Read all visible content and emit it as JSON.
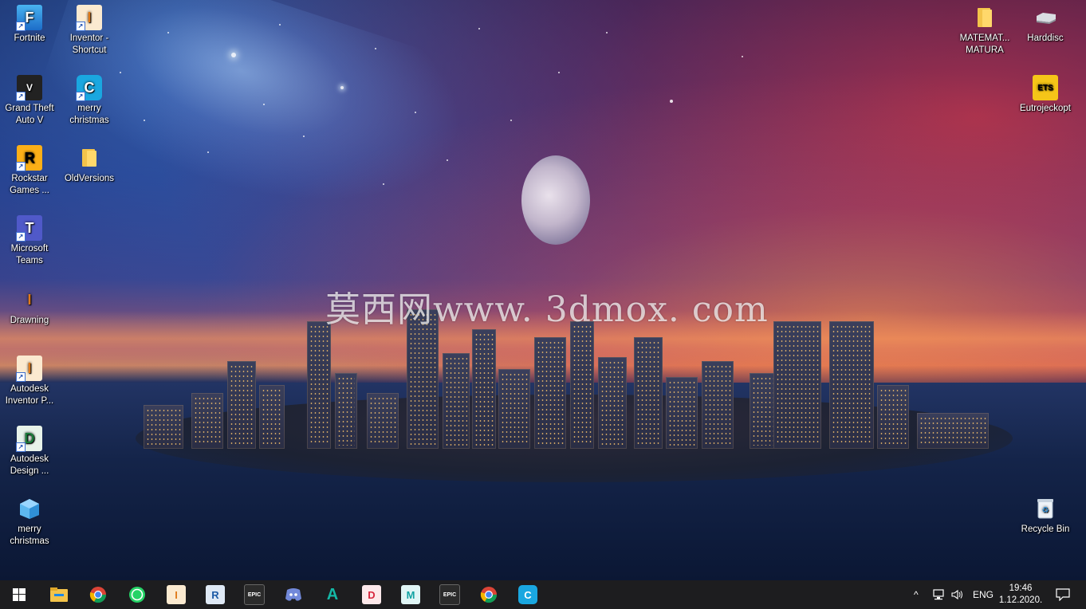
{
  "wallpaper": {
    "watermark": "莫西网www. 3dmox. com"
  },
  "desktop_icons_left": [
    {
      "label": "Fortnite",
      "icon": "fortnite-icon"
    },
    {
      "label": "Inventor - Shortcut",
      "icon": "inventor-icon"
    },
    {
      "label": "Grand Theft Auto V",
      "icon": "gta-v-icon"
    },
    {
      "label": "merry christmas",
      "icon": "app-c-icon"
    },
    {
      "label": "Rockstar Games ...",
      "icon": "rockstar-icon"
    },
    {
      "label": "OldVersions",
      "icon": "folder-icon"
    },
    {
      "label": "Microsoft Teams",
      "icon": "teams-icon"
    },
    {
      "label": "Drawning",
      "icon": "inventor-small-icon"
    },
    {
      "label": "Autodesk Inventor P...",
      "icon": "autodesk-inventor-icon"
    },
    {
      "label": "Autodesk Design ...",
      "icon": "autodesk-design-icon"
    },
    {
      "label": "merry christmas",
      "icon": "cube-icon"
    }
  ],
  "desktop_icons_right": [
    {
      "label": "MATEMAT... MATURA",
      "icon": "folder-icon"
    },
    {
      "label": "Harddisc",
      "icon": "hard-disk-icon"
    },
    {
      "label": "Eutrojeckopt",
      "icon": "eurotruck-icon"
    },
    {
      "label": "Recycle Bin",
      "icon": "recycle-bin-icon"
    }
  ],
  "taskbar": {
    "start": "windows-start-icon",
    "apps": [
      {
        "name": "file-explorer",
        "glyph": ""
      },
      {
        "name": "chrome",
        "glyph": ""
      },
      {
        "name": "whatsapp",
        "glyph": ""
      },
      {
        "name": "inventor",
        "glyph": "I"
      },
      {
        "name": "revit",
        "glyph": "R"
      },
      {
        "name": "epic-games",
        "glyph": "EPIC"
      },
      {
        "name": "discord",
        "glyph": ""
      },
      {
        "name": "autocad",
        "glyph": "A"
      },
      {
        "name": "autodesk-d",
        "glyph": "D"
      },
      {
        "name": "maya",
        "glyph": "M"
      },
      {
        "name": "epic-games-2",
        "glyph": "EPIC"
      },
      {
        "name": "chrome-2",
        "glyph": ""
      },
      {
        "name": "app-c",
        "glyph": "C"
      }
    ],
    "tray": {
      "chevron": "^",
      "language": "ENG",
      "time": "19:46",
      "date": "1.12.2020."
    }
  },
  "colors": {
    "taskbar_bg": "#1d1d1f",
    "accent_blue": "#0078d7"
  }
}
